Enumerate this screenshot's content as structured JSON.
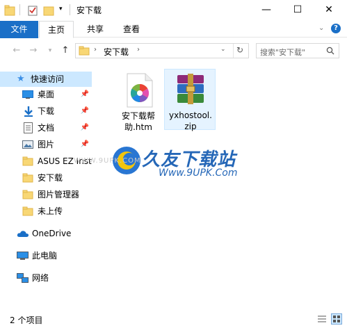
{
  "window": {
    "title": "安下载",
    "minimize_glyph": "—",
    "maximize_glyph": "☐",
    "close_glyph": "✕"
  },
  "ribbon": {
    "tabs": [
      {
        "label": "文件"
      },
      {
        "label": "主页"
      },
      {
        "label": "共享"
      },
      {
        "label": "查看"
      }
    ]
  },
  "address": {
    "path": [
      "安下载"
    ],
    "search_placeholder": "搜索\"安下载\""
  },
  "nav": {
    "quick_access": "快速访问",
    "items": [
      {
        "label": "桌面",
        "icon": "desktop-icon",
        "pinned": true
      },
      {
        "label": "下载",
        "icon": "download-icon",
        "pinned": true
      },
      {
        "label": "文档",
        "icon": "document-icon",
        "pinned": true
      },
      {
        "label": "图片",
        "icon": "picture-icon",
        "pinned": true
      },
      {
        "label": "ASUS EZ Insta",
        "icon": "folder-icon",
        "pinned": false
      },
      {
        "label": "安下载",
        "icon": "folder-icon",
        "pinned": false
      },
      {
        "label": "图片管理器",
        "icon": "folder-icon",
        "pinned": false
      },
      {
        "label": "未上传",
        "icon": "folder-icon",
        "pinned": false
      }
    ],
    "onedrive": "OneDrive",
    "this_pc": "此电脑",
    "network": "网络"
  },
  "files": [
    {
      "name_line1": "安下载帮",
      "name_line2": "助.htm",
      "icon": "html-file-icon"
    },
    {
      "name_line1": "yxhostool.",
      "name_line2": "zip",
      "icon": "winrar-archive-icon"
    }
  ],
  "watermark": {
    "brand": "久友下载站",
    "url": "Www.9UPK.Com",
    "faint_text": "WWW.9UPK.COM"
  },
  "status": {
    "item_count": "2 个项目"
  },
  "colors": {
    "accent": "#1a6fc7",
    "selection": "#cce8ff",
    "folder": "#f8d775"
  }
}
